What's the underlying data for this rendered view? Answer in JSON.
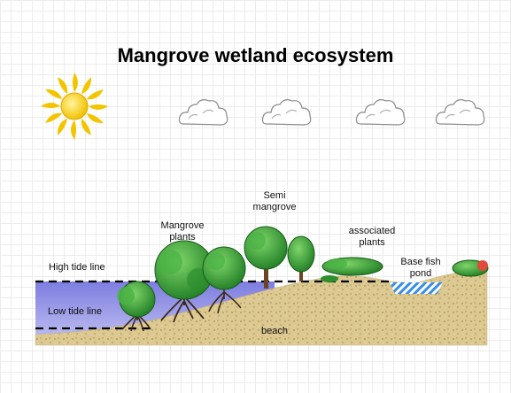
{
  "title": "Mangrove wetland ecosystem",
  "labels": {
    "high_tide_line": "High tide line",
    "low_tide_line": "Low tide line",
    "mangrove_plants": "Mangrove\nplants",
    "semi_mangrove": "Semi\nmangrove",
    "associated_plants": "associated\nplants",
    "base_fish_pond": "Base fish\npond",
    "beach": "beach"
  },
  "colors": {
    "sun": "#f5c400",
    "water": "#8f8fe6",
    "sand": "#d8c48a",
    "tree": "#3aa63a"
  }
}
